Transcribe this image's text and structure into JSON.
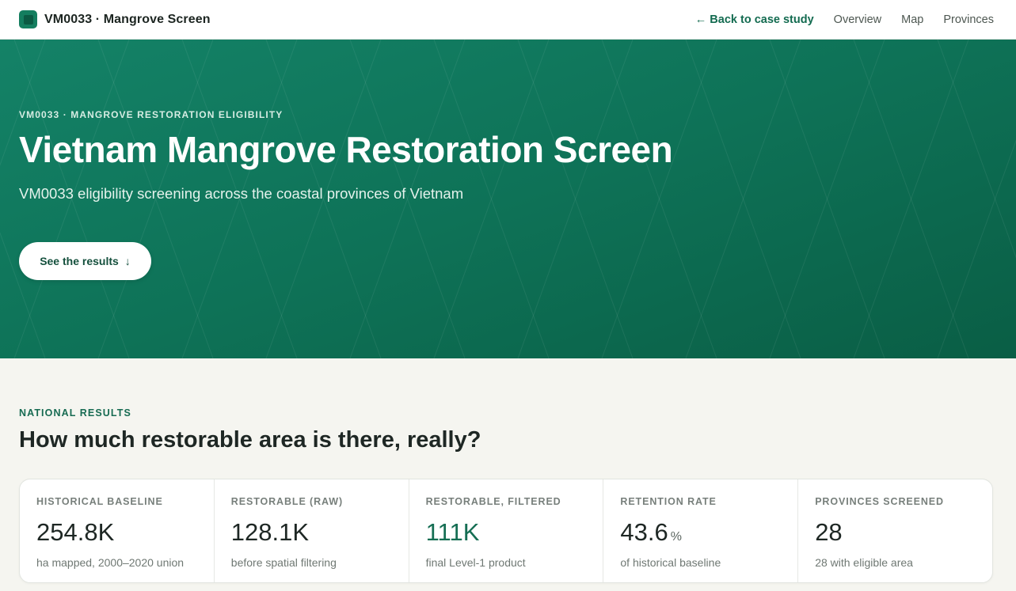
{
  "header": {
    "brand_title": "VM0033 · Mangrove Screen",
    "nav": [
      {
        "label": "← Back to case study",
        "name": "nav-back-to-case-study"
      },
      {
        "label": "Overview",
        "name": "nav-overview"
      },
      {
        "label": "Map",
        "name": "nav-map"
      },
      {
        "label": "Provinces",
        "name": "nav-provinces"
      }
    ]
  },
  "hero": {
    "eyebrow": "VM0033 · MANGROVE RESTORATION ELIGIBILITY",
    "title": "Vietnam Mangrove Restoration Screen",
    "subtitle": "VM0033 eligibility screening across the coastal provinces of Vietnam",
    "cta_label": "See the results",
    "cta_icon": "↓"
  },
  "results": {
    "eyebrow": "NATIONAL RESULTS",
    "title": "How much restorable area is there, really?",
    "stats": [
      {
        "label": "HISTORICAL BASELINE",
        "value": "254.8K",
        "unit": "",
        "sub": "ha mapped, 2000–2020 union"
      },
      {
        "label": "RESTORABLE (RAW)",
        "value": "128.1K",
        "unit": "",
        "sub": "before spatial filtering"
      },
      {
        "label": "RESTORABLE, FILTERED",
        "value": "111K",
        "unit": "",
        "sub": "final Level-1 product"
      },
      {
        "label": "RETENTION RATE",
        "value": "43.6",
        "unit": "%",
        "sub": "of historical baseline"
      },
      {
        "label": "PROVINCES SCREENED",
        "value": "28",
        "unit": "",
        "sub": "28 with eligible area"
      }
    ]
  },
  "colors": {
    "brand": "#147e5f",
    "hero_gradient_start": "#148267",
    "hero_gradient_end": "#0a5e45",
    "accent_text": "#156e53",
    "page_background": "#f5f5f0"
  }
}
